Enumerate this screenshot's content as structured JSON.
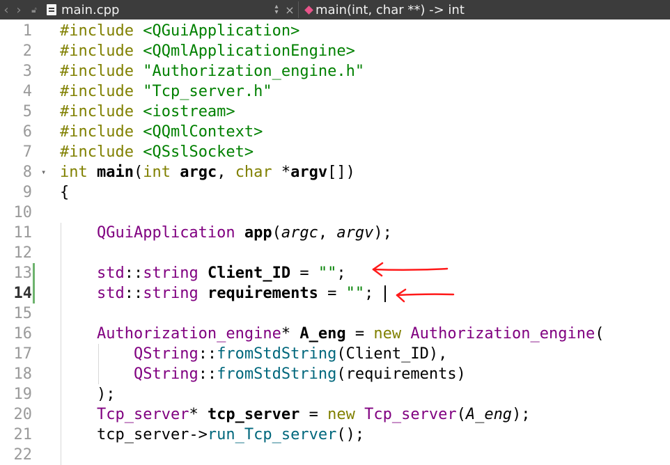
{
  "toolbar": {
    "back_icon": "chevron-left",
    "forward_icon": "chevron-right",
    "lock_icon": "unlocked",
    "filename": "main.cpp",
    "function_signature": "main(int, char **) -> int"
  },
  "editor": {
    "current_line": "14",
    "line_numbers": [
      "1",
      "2",
      "3",
      "4",
      "5",
      "6",
      "7",
      "8",
      "9",
      "10",
      "11",
      "12",
      "13",
      "14",
      "15",
      "16",
      "17",
      "18",
      "19",
      "20",
      "21",
      "22"
    ],
    "lines": [
      [
        {
          "t": "#include ",
          "c": "kw"
        },
        {
          "t": "<QGuiApplication>",
          "c": "str"
        }
      ],
      [
        {
          "t": "#include ",
          "c": "kw"
        },
        {
          "t": "<QQmlApplicationEngine>",
          "c": "str"
        }
      ],
      [
        {
          "t": "#include ",
          "c": "kw"
        },
        {
          "t": "\"Authorization_engine.h\"",
          "c": "str"
        }
      ],
      [
        {
          "t": "#include ",
          "c": "kw"
        },
        {
          "t": "\"Tcp_server.h\"",
          "c": "str"
        }
      ],
      [
        {
          "t": "#include ",
          "c": "kw"
        },
        {
          "t": "<iostream>",
          "c": "str"
        }
      ],
      [
        {
          "t": "#include ",
          "c": "kw"
        },
        {
          "t": "<QQmlContext>",
          "c": "str"
        }
      ],
      [
        {
          "t": "#include ",
          "c": "kw"
        },
        {
          "t": "<QSslSocket>",
          "c": "str"
        }
      ],
      [
        {
          "t": "int ",
          "c": "kw"
        },
        {
          "t": "main",
          "c": "bold"
        },
        {
          "t": "(",
          "c": ""
        },
        {
          "t": "int ",
          "c": "kw"
        },
        {
          "t": "argc",
          "c": "bold"
        },
        {
          "t": ", ",
          "c": ""
        },
        {
          "t": "char ",
          "c": "kw"
        },
        {
          "t": "*",
          "c": ""
        },
        {
          "t": "argv",
          "c": "bold"
        },
        {
          "t": "[])",
          "c": ""
        }
      ],
      [
        {
          "t": "{",
          "c": ""
        }
      ],
      [],
      [
        {
          "t": "    ",
          "c": ""
        },
        {
          "t": "QGuiApplication ",
          "c": "cls"
        },
        {
          "t": "app",
          "c": "bold"
        },
        {
          "t": "(",
          "c": ""
        },
        {
          "t": "argc",
          "c": "ital"
        },
        {
          "t": ", ",
          "c": ""
        },
        {
          "t": "argv",
          "c": "ital"
        },
        {
          "t": ");",
          "c": ""
        }
      ],
      [],
      [
        {
          "t": "    ",
          "c": ""
        },
        {
          "t": "std",
          "c": "cls"
        },
        {
          "t": "::",
          "c": ""
        },
        {
          "t": "string ",
          "c": "cls"
        },
        {
          "t": "Client_ID",
          "c": "bold"
        },
        {
          "t": " = ",
          "c": ""
        },
        {
          "t": "\"\"",
          "c": "str"
        },
        {
          "t": ";",
          "c": ""
        }
      ],
      [
        {
          "t": "    ",
          "c": ""
        },
        {
          "t": "std",
          "c": "cls"
        },
        {
          "t": "::",
          "c": ""
        },
        {
          "t": "string ",
          "c": "cls"
        },
        {
          "t": "requirements",
          "c": "bold"
        },
        {
          "t": " = ",
          "c": ""
        },
        {
          "t": "\"\"",
          "c": "str"
        },
        {
          "t": ";",
          "c": ""
        }
      ],
      [],
      [
        {
          "t": "    ",
          "c": ""
        },
        {
          "t": "Authorization_engine",
          "c": "cls"
        },
        {
          "t": "* ",
          "c": ""
        },
        {
          "t": "A_eng",
          "c": "bold"
        },
        {
          "t": " = ",
          "c": ""
        },
        {
          "t": "new ",
          "c": "kw"
        },
        {
          "t": "Authorization_engine",
          "c": "cls"
        },
        {
          "t": "(",
          "c": ""
        }
      ],
      [
        {
          "t": "        ",
          "c": ""
        },
        {
          "t": "QString",
          "c": "cls"
        },
        {
          "t": "::",
          "c": ""
        },
        {
          "t": "fromStdString",
          "c": "fn"
        },
        {
          "t": "(Client_ID),",
          "c": ""
        }
      ],
      [
        {
          "t": "        ",
          "c": ""
        },
        {
          "t": "QString",
          "c": "cls"
        },
        {
          "t": "::",
          "c": ""
        },
        {
          "t": "fromStdString",
          "c": "fn"
        },
        {
          "t": "(requirements)",
          "c": ""
        }
      ],
      [
        {
          "t": "    );",
          "c": ""
        }
      ],
      [
        {
          "t": "    ",
          "c": ""
        },
        {
          "t": "Tcp_server",
          "c": "cls"
        },
        {
          "t": "* ",
          "c": ""
        },
        {
          "t": "tcp_server",
          "c": "bold"
        },
        {
          "t": " = ",
          "c": ""
        },
        {
          "t": "new ",
          "c": "kw"
        },
        {
          "t": "Tcp_server",
          "c": "cls"
        },
        {
          "t": "(",
          "c": ""
        },
        {
          "t": "A_eng",
          "c": "ital"
        },
        {
          "t": ");",
          "c": ""
        }
      ],
      [
        {
          "t": "    tcp_server->",
          "c": ""
        },
        {
          "t": "run_Tcp_server",
          "c": "fn"
        },
        {
          "t": "();",
          "c": ""
        }
      ],
      []
    ]
  },
  "colors": {
    "keyword": "#808000",
    "string": "#008000",
    "type": "#800080",
    "function": "#00677c",
    "annotation_arrow": "#ff0000"
  }
}
